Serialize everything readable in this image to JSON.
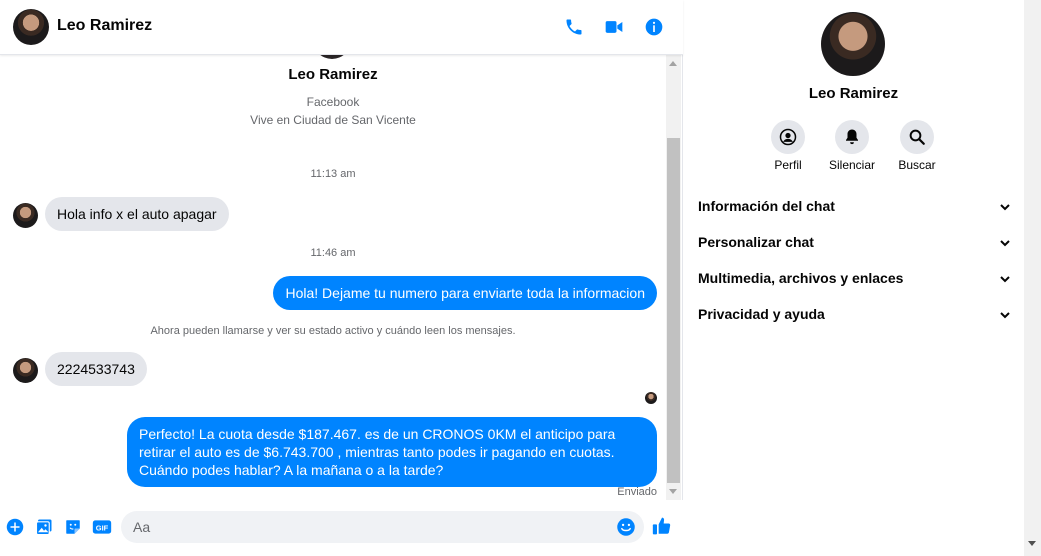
{
  "header": {
    "contact_name": "Leo Ramirez",
    "icons": [
      "phone-icon",
      "video-icon",
      "info-icon"
    ]
  },
  "profile": {
    "name": "Leo Ramirez",
    "source": "Facebook",
    "location": "Vive en Ciudad de San Vicente"
  },
  "conversation": {
    "time_1": "11:13 am",
    "msg_in_1": "Hola info x el auto apagar",
    "time_2": "11:46 am",
    "msg_out_1": "Hola! Dejame tu numero  para enviarte toda la informacion",
    "notice": "Ahora pueden llamarse y ver su estado activo y cuándo leen los mensajes.",
    "msg_in_2": "2224533743",
    "msg_out_2": "Perfecto! La cuota desde $187.467. es de un CRONOS 0KM el anticipo para retirar el auto es de $6.743.700 , mientras tanto podes ir pagando en cuotas. Cuándo podes hablar? A la mañana o a la tarde?",
    "status": "Enviado"
  },
  "composer": {
    "placeholder": "Aa",
    "icons": [
      "add-icon",
      "image-icon",
      "sticker-icon",
      "gif-icon",
      "emoji-icon",
      "like-icon"
    ]
  },
  "sidebar": {
    "name": "Leo Ramirez",
    "actions": [
      {
        "label": "Perfil",
        "icon": "profile-icon"
      },
      {
        "label": "Silenciar",
        "icon": "bell-icon"
      },
      {
        "label": "Buscar",
        "icon": "search-icon"
      }
    ],
    "sections": [
      "Información del chat",
      "Personalizar chat",
      "Multimedia, archivos y enlaces",
      "Privacidad y ayuda"
    ]
  },
  "colors": {
    "accent": "#0084ff",
    "bubble_in": "#e4e6eb",
    "muted_text": "#65676b"
  }
}
